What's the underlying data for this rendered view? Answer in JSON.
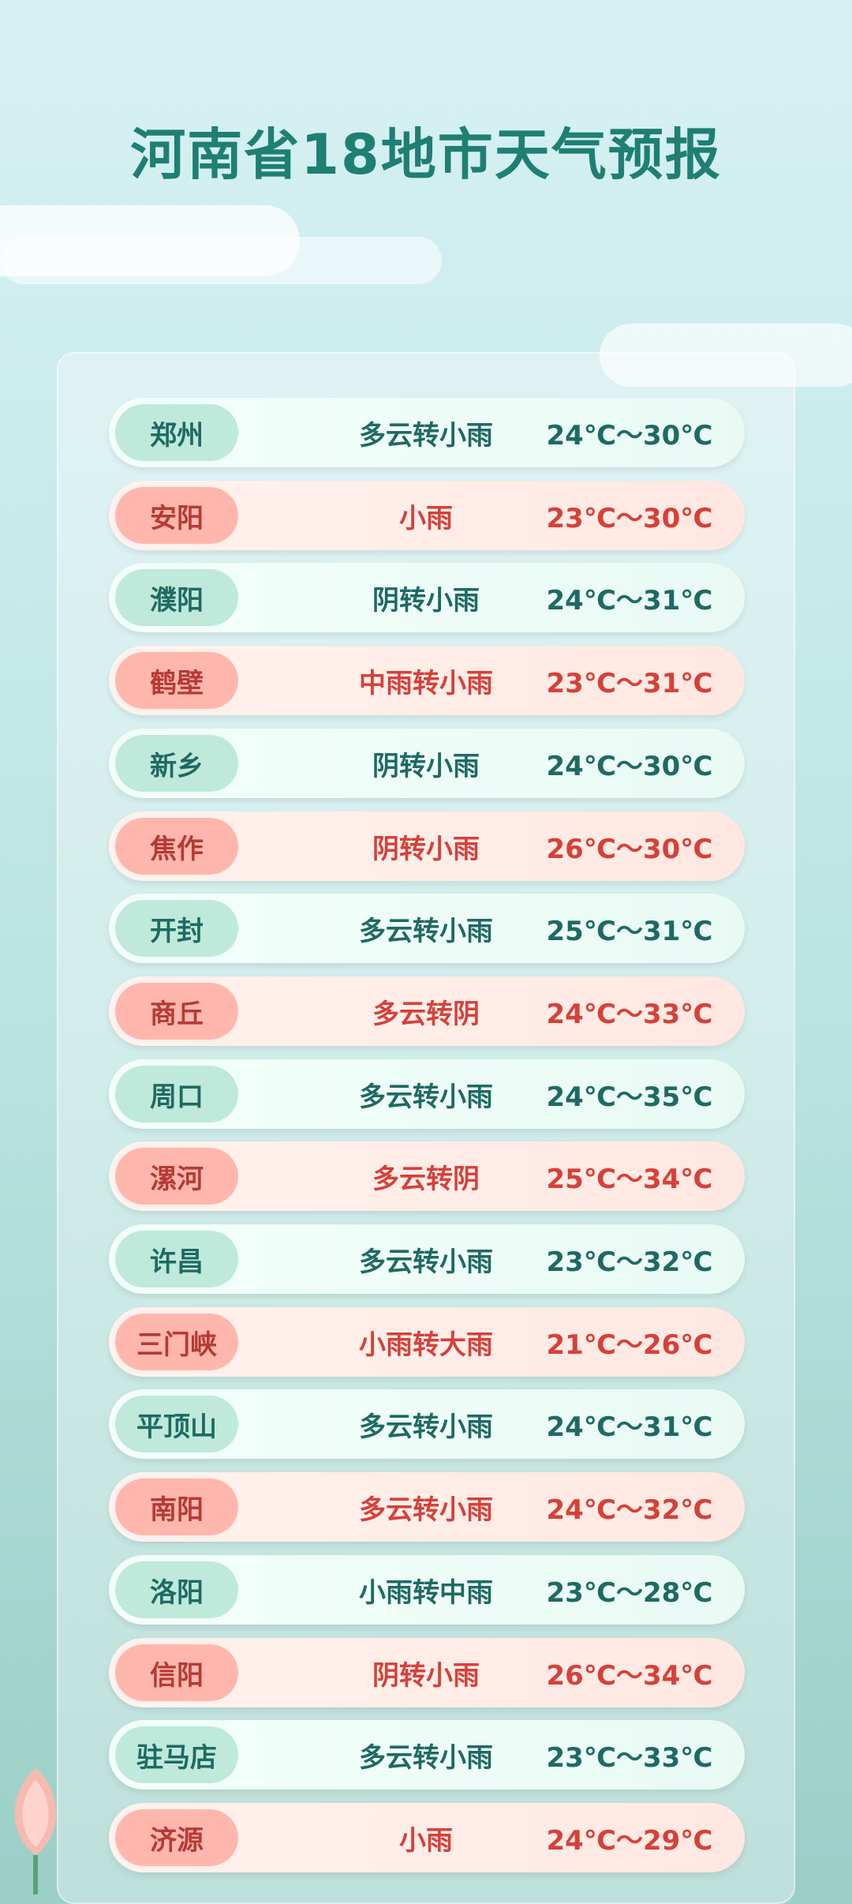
{
  "title": "河南省18地市天气预报",
  "colors": {
    "title_green": "#1e7f72",
    "green_text": "#1e6a63",
    "red_text": "#d5413a",
    "green_pill": "#bfe9da",
    "red_pill": "#ffb7ad"
  },
  "rows": [
    {
      "city": "郑州",
      "weather": "多云转小雨",
      "temp": "24℃～30℃",
      "style": "g"
    },
    {
      "city": "安阳",
      "weather": "小雨",
      "temp": "23℃～30℃",
      "style": "r"
    },
    {
      "city": "濮阳",
      "weather": "阴转小雨",
      "temp": "24℃～31℃",
      "style": "g"
    },
    {
      "city": "鹤壁",
      "weather": "中雨转小雨",
      "temp": "23℃～31℃",
      "style": "r"
    },
    {
      "city": "新乡",
      "weather": "阴转小雨",
      "temp": "24℃～30℃",
      "style": "g"
    },
    {
      "city": "焦作",
      "weather": "阴转小雨",
      "temp": "26℃～30℃",
      "style": "r"
    },
    {
      "city": "开封",
      "weather": "多云转小雨",
      "temp": "25℃～31℃",
      "style": "g"
    },
    {
      "city": "商丘",
      "weather": "多云转阴",
      "temp": "24℃～33℃",
      "style": "r"
    },
    {
      "city": "周口",
      "weather": "多云转小雨",
      "temp": "24℃～35℃",
      "style": "g"
    },
    {
      "city": "漯河",
      "weather": "多云转阴",
      "temp": "25℃～34℃",
      "style": "r"
    },
    {
      "city": "许昌",
      "weather": "多云转小雨",
      "temp": "23℃～32℃",
      "style": "g"
    },
    {
      "city": "三门峡",
      "weather": "小雨转大雨",
      "temp": "21℃～26℃",
      "style": "r"
    },
    {
      "city": "平顶山",
      "weather": "多云转小雨",
      "temp": "24℃～31℃",
      "style": "g"
    },
    {
      "city": "南阳",
      "weather": "多云转小雨",
      "temp": "24℃～32℃",
      "style": "r"
    },
    {
      "city": "洛阳",
      "weather": "小雨转中雨",
      "temp": "23℃～28℃",
      "style": "g"
    },
    {
      "city": "信阳",
      "weather": "阴转小雨",
      "temp": "26℃～34℃",
      "style": "r"
    },
    {
      "city": "驻马店",
      "weather": "多云转小雨",
      "temp": "23℃～33℃",
      "style": "g"
    },
    {
      "city": "济源",
      "weather": "小雨",
      "temp": "24℃～29℃",
      "style": "r"
    }
  ]
}
